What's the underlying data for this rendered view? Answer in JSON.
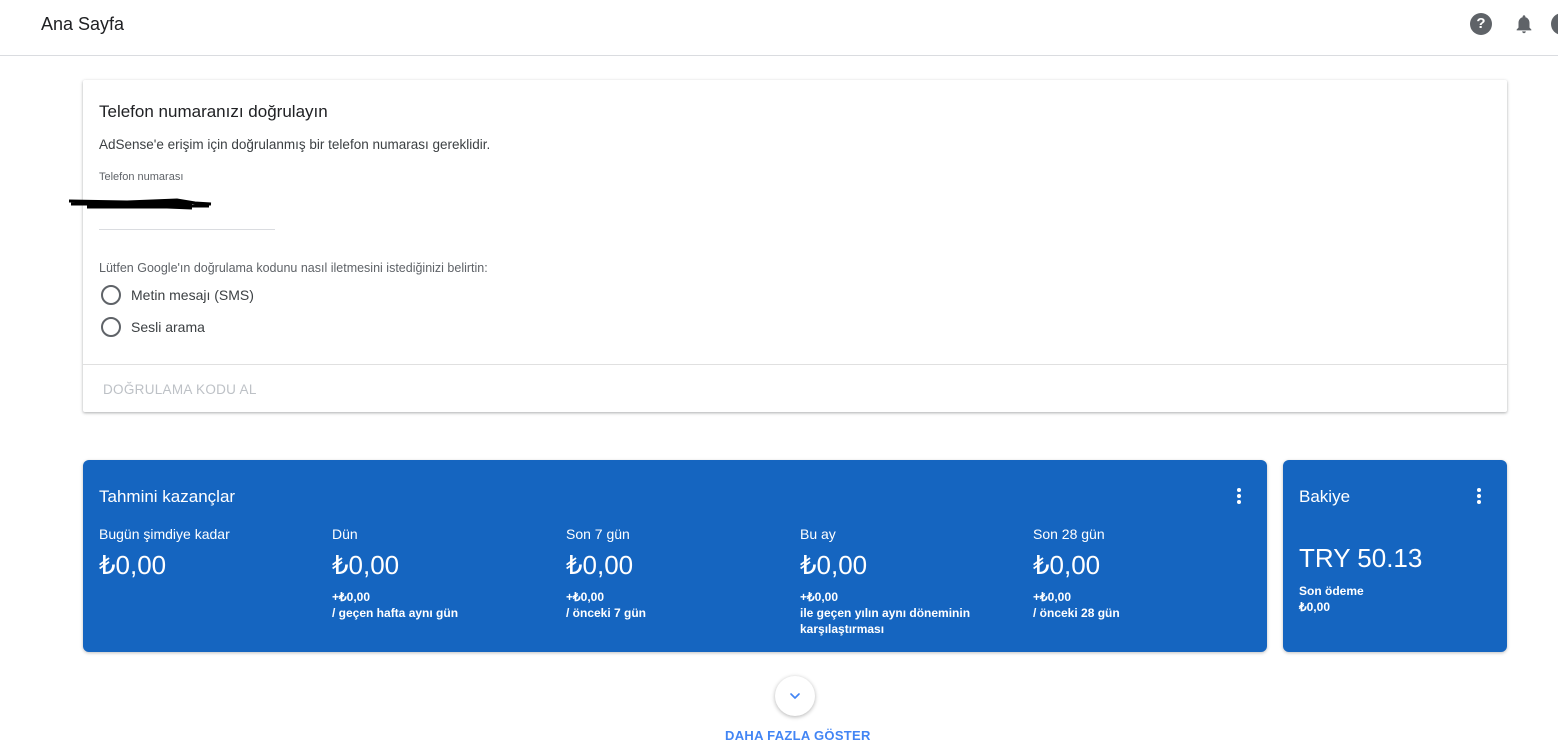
{
  "header": {
    "title": "Ana Sayfa",
    "help_icon": "help-circle-icon",
    "notifications_icon": "bell-icon",
    "avatar_icon": "account-avatar"
  },
  "verify": {
    "heading": "Telefon numaranızı doğrulayın",
    "description": "AdSense'e erişim için doğrulanmış bir telefon numarası gereklidir.",
    "phone_label": "Telefon numarası",
    "prompt": "Lütfen Google'ın doğrulama kodunu nasıl iletmesini istediğinizi belirtin:",
    "options": [
      {
        "label": "Metin mesajı (SMS)"
      },
      {
        "label": "Sesli arama"
      }
    ],
    "action_label": "DOĞRULAMA KODU AL"
  },
  "earnings": {
    "title": "Tahmini kazançlar",
    "metrics": [
      {
        "label": "Bugün şimdiye kadar",
        "value": "₺0,00",
        "change": "",
        "compare": ""
      },
      {
        "label": "Dün",
        "value": "₺0,00",
        "change": "+₺0,00",
        "compare": "/ geçen hafta aynı gün"
      },
      {
        "label": "Son 7 gün",
        "value": "₺0,00",
        "change": "+₺0,00",
        "compare": "/ önceki 7 gün"
      },
      {
        "label": "Bu ay",
        "value": "₺0,00",
        "change": "+₺0,00",
        "compare": "ile geçen yılın aynı döneminin karşılaştırması"
      },
      {
        "label": "Son 28 gün",
        "value": "₺0,00",
        "change": "+₺0,00",
        "compare": "/ önceki 28 gün"
      }
    ]
  },
  "balance": {
    "title": "Bakiye",
    "value": "TRY 50.13",
    "last_payment_label": "Son ödeme",
    "last_payment_value": "₺0,00"
  },
  "show_more": {
    "label": "DAHA FAZLA GÖSTER"
  },
  "colors": {
    "card_blue": "#1565c0",
    "link_blue": "#4285f4",
    "disabled_text": "#bdc1c6"
  }
}
